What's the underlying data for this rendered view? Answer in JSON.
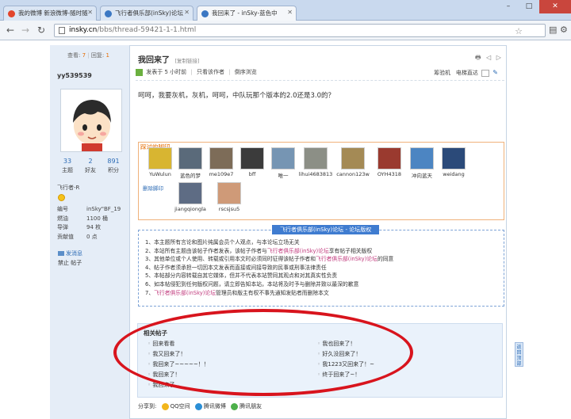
{
  "tabs": [
    {
      "title": "我的微博 新浪微博-随时随",
      "active": false,
      "fav_color": "#e2452c"
    },
    {
      "title": "飞行者俱乐部(inSky)论坛",
      "active": false,
      "fav_color": "#3c78c3"
    },
    {
      "title": "我回来了 - inSky-蓝色中",
      "active": true,
      "fav_color": "#3c78c3"
    }
  ],
  "window_controls": [
    "–",
    "□",
    "✕"
  ],
  "address_bar": {
    "host": "insky.cn",
    "path": "/bbs/thread-59421-1-1.html"
  },
  "author": {
    "stats_line": {
      "views_label": "查看:",
      "views": "7",
      "replies_label": "回复:",
      "replies": "1"
    },
    "username": "yy539539",
    "counts": [
      {
        "value": "33",
        "label": "主题"
      },
      {
        "value": "2",
        "label": "好友"
      },
      {
        "value": "891",
        "label": "积分"
      }
    ],
    "rank": "飞行者-R",
    "profile": [
      {
        "key": "编号",
        "value": "inSky\"BF_19"
      },
      {
        "key": "燃油",
        "value": "1100 桶"
      },
      {
        "key": "导弹",
        "value": "94 枚"
      },
      {
        "key": "贡献值",
        "value": "0 点"
      }
    ],
    "send_message": "发消息",
    "ban": "禁止 帖子"
  },
  "post": {
    "title": "我回来了",
    "copy_link": "[复制链接]",
    "title_icons": "🖶 ◁ ▷",
    "meta": {
      "posted": "发表于 5 小时前",
      "only_author": "只看该作者",
      "reverse": "倒序浏览"
    },
    "meta_right": {
      "read_mode": "筹验机",
      "sort": "电梯直达"
    },
    "body": "呵呵，我要灰机，灰机，呵呵，中队玩那个版本的2.0还是3.0的？",
    "footprints": {
      "title": "踩过的脚印",
      "delete": "删除脚印",
      "users": [
        {
          "name": "YuWulun",
          "color": "#d8b531"
        },
        {
          "name": "蓝色的梦",
          "color": "#5a6a7a"
        },
        {
          "name": "me109e7",
          "color": "#7d6c58"
        },
        {
          "name": "bff",
          "color": "#3b3b3b"
        },
        {
          "name": "唯一",
          "color": "#7695b3"
        },
        {
          "name": "lihui4683813",
          "color": "#8c8f86"
        },
        {
          "name": "cannon123w",
          "color": "#a48a55"
        },
        {
          "name": "OYH4318",
          "color": "#9a3a2f"
        },
        {
          "name": "冲向蓝天",
          "color": "#4c85c2"
        },
        {
          "name": "weidang",
          "color": "#2b4a79"
        },
        {
          "name": "jiangqiongla",
          "color": "#5e6c84"
        },
        {
          "name": "rscsjsu5",
          "color": "#cf9a78"
        }
      ]
    },
    "notice": {
      "header": "飞行者俱乐部(inSky)论坛 - 论坛版权",
      "items": [
        "1、本主题所有言论和图片纯属会员个人观点，与本论坛立场无关",
        "2、本站所有主题由该帖子作者发表，该帖子作者与飞行者俱乐部(inSky)论坛享有帖子相关版权",
        "3、其他单位或个人使用、转载或引用本文时必须同时征得该帖子作者和飞行者俱乐部(inSky)论坛的同意",
        "4、帖子作者须承担一切因本文发表而直接或间接导致的民事或刑事法律责任",
        "5、本帖部分内容转载自其它媒体，但并不代表本站赞同其观点和对其真实性负责",
        "6、如本帖侵犯到任何版权问题，请立即告知本站，本站将及时予与删除并致以最深的歉意",
        "7、飞行者俱乐部(inSky)论坛管理员和版主有权不事先通知发贴者而删除本文"
      ]
    },
    "related": {
      "title": "相关帖子",
      "left": [
        "回来看看",
        "我又回来了！",
        "我回来了~~~~~！！",
        "我回来了！",
        "我回来了。。"
      ],
      "right": [
        "我也回来了！",
        "好久没回来了！",
        "我1223又回来了！~",
        "终于回来了~！"
      ]
    },
    "share": {
      "label": "分享到:",
      "targets": [
        "QQ空间",
        "腾讯微博",
        "腾讯朋友"
      ]
    },
    "return_top": "返回顶部"
  },
  "annotation_color": "#d8141d"
}
